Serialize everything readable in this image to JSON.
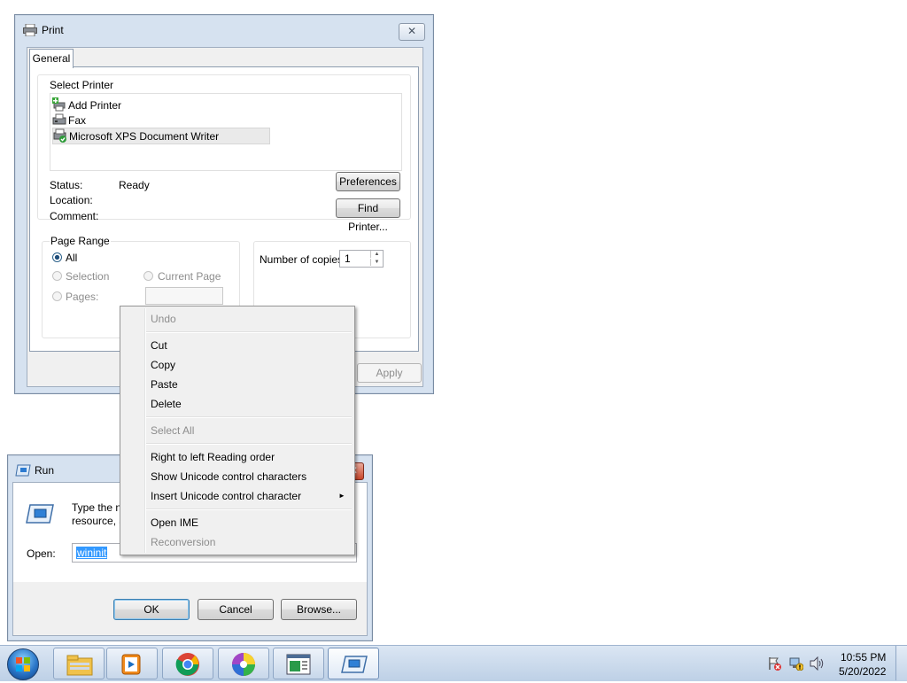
{
  "print_dialog": {
    "title": "Print",
    "tab_general": "General",
    "select_printer_label": "Select Printer",
    "printers": [
      "Add Printer",
      "Fax",
      "Microsoft XPS Document Writer"
    ],
    "status_label": "Status:",
    "status_value": "Ready",
    "location_label": "Location:",
    "comment_label": "Comment:",
    "preferences_button": "Preferences",
    "find_printer_button": "Find Printer...",
    "page_range_label": "Page Range",
    "all_label": "All",
    "selection_label": "Selection",
    "current_page_label": "Current Page",
    "pages_label": "Pages:",
    "copies_label": "Number of copies:",
    "copies_value": "1",
    "apply_button": "Apply"
  },
  "run_dialog": {
    "title": "Run",
    "description_line1": "Type the n",
    "description_line2": "resource, a",
    "open_label": "Open:",
    "open_value": "wininit",
    "ok_button": "OK",
    "cancel_button": "Cancel",
    "browse_button": "Browse..."
  },
  "context_menu": {
    "undo": "Undo",
    "cut": "Cut",
    "copy": "Copy",
    "paste": "Paste",
    "delete": "Delete",
    "select_all": "Select All",
    "rtl_reading": "Right to left Reading order",
    "show_unicode": "Show Unicode control characters",
    "insert_unicode": "Insert Unicode control character",
    "submenu_arrow": "►",
    "open_ime": "Open IME",
    "reconversion": "Reconversion"
  },
  "taskbar": {
    "time": "10:55 PM",
    "date": "5/20/2022",
    "pinned_icons": [
      "windows-explorer-icon",
      "media-player-icon",
      "chrome-icon",
      "color-wheel-icon",
      "control-panel-icon",
      "run-icon"
    ]
  },
  "colors": {
    "selection_blue": "#3399ff",
    "window_frame": "#d6e2f0",
    "taskbar": "#bdd0e6"
  }
}
